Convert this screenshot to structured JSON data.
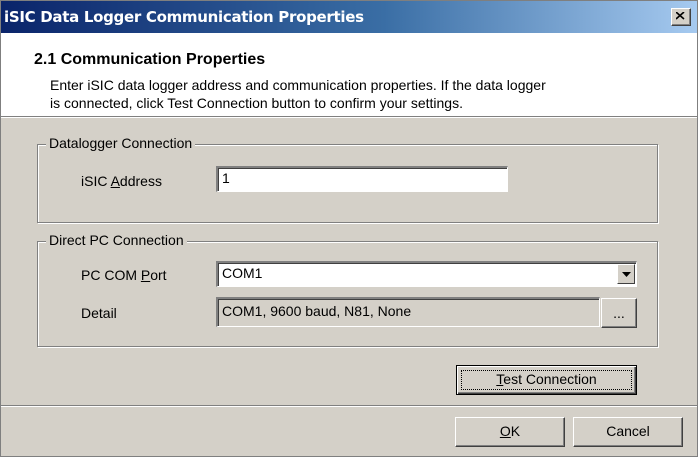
{
  "window": {
    "title": "iSIC Data Logger Communication Properties"
  },
  "header": {
    "title": "2.1 Communication Properties",
    "desc_line1": "Enter iSIC data logger address and communication properties. If the data logger",
    "desc_line2": "is connected, click Test Connection button to confirm your settings."
  },
  "datalogger_group": {
    "label": "Datalogger Connection",
    "address_label_pre": "iSIC ",
    "address_label_u": "A",
    "address_label_post": "ddress",
    "address_value": "1"
  },
  "direct_group": {
    "label": "Direct PC Connection",
    "port_label_pre": "PC COM ",
    "port_label_u": "P",
    "port_label_post": "ort",
    "port_value": "COM1",
    "detail_label": "Detail",
    "detail_value": "COM1, 9600 baud, N81, None",
    "browse_label": "..."
  },
  "buttons": {
    "test_u": "T",
    "test_rest": "est Connection",
    "ok_u": "O",
    "ok_rest": "K",
    "cancel": "Cancel"
  },
  "icons": {
    "close": "close-icon",
    "dropdown": "chevron-down-icon"
  }
}
